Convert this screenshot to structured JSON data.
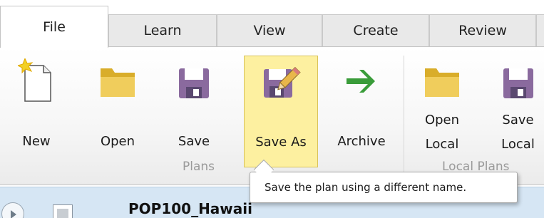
{
  "tabs": [
    {
      "label": "File",
      "active": true
    },
    {
      "label": "Learn",
      "active": false
    },
    {
      "label": "View",
      "active": false
    },
    {
      "label": "Create",
      "active": false
    },
    {
      "label": "Review",
      "active": false
    }
  ],
  "ribbon": {
    "plans_group": {
      "label": "Plans",
      "buttons": {
        "new": {
          "label": "New",
          "icon": "new-document-icon"
        },
        "open": {
          "label": "Open",
          "icon": "folder-icon"
        },
        "save": {
          "label": "Save",
          "icon": "floppy-disk-icon"
        },
        "save_as": {
          "label": "Save As",
          "icon": "floppy-pencil-icon",
          "selected": true
        },
        "archive": {
          "label": "Archive",
          "icon": "green-arrow-icon"
        }
      }
    },
    "local_group": {
      "label": "Local Plans",
      "buttons": {
        "open_local": {
          "line1": "Open",
          "line2": "Local",
          "icon": "folder-icon"
        },
        "save_local": {
          "line1": "Save",
          "line2": "Local",
          "icon": "floppy-disk-icon"
        }
      }
    }
  },
  "tooltip": {
    "text": "Save the plan using a different name."
  },
  "list": {
    "row_title": "POP100_Hawaii"
  },
  "colors": {
    "selected_bg": "#fdf0a0",
    "folder": "#e8c14a",
    "floppy": "#8a6a9e",
    "arrow": "#3a9c3a",
    "row_bg": "#d6e6f4"
  }
}
